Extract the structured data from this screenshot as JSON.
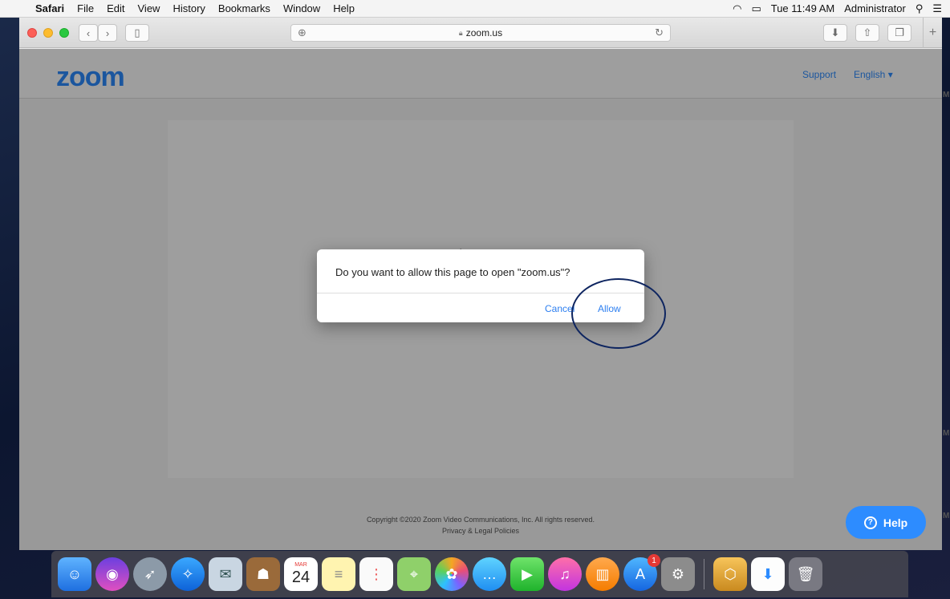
{
  "menubar": {
    "app": "Safari",
    "menus": [
      "File",
      "Edit",
      "View",
      "History",
      "Bookmarks",
      "Window",
      "Help"
    ],
    "time": "Tue 11:49 AM",
    "user": "Administrator"
  },
  "browser": {
    "url": "zoom.us"
  },
  "zoom": {
    "logo": "zoom",
    "support": "Support",
    "language": "English ▾",
    "copyright": "Copyright ©2020 Zoom Video Communications, Inc. All rights reserved.",
    "privacy": "Privacy & Legal Policies",
    "help": "Help"
  },
  "dialog": {
    "message": "Do you want to allow this page to open \"zoom.us\"?",
    "cancel": "Cancel",
    "allow": "Allow"
  },
  "dock": {
    "calendar_month": "MAR",
    "calendar_day": "24",
    "appstore_badge": "1"
  },
  "colors": {
    "zoom_blue": "#2d8cff",
    "dialog_link": "#2d7ff0",
    "annotation_circle": "#0e2560"
  }
}
